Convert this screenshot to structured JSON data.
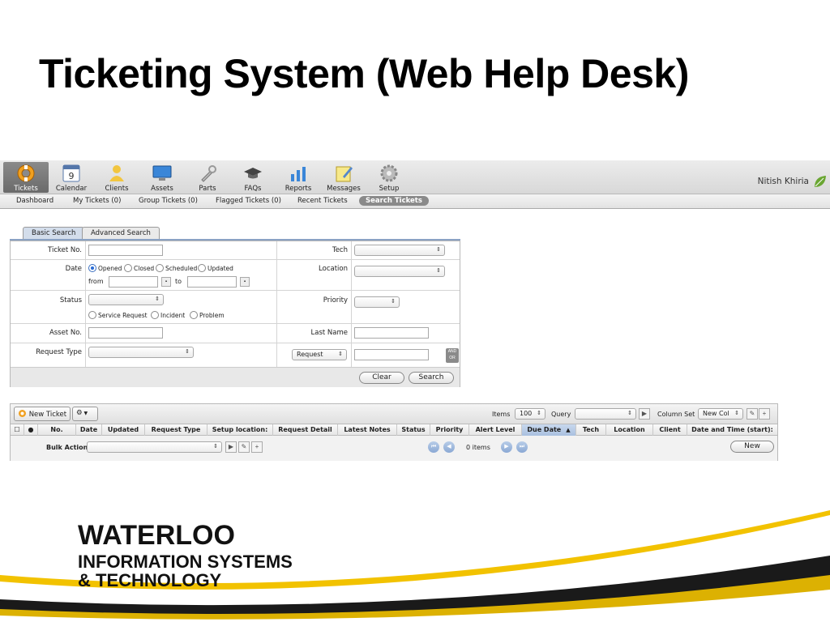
{
  "slide": {
    "title": "Ticketing System (Web Help Desk)"
  },
  "toolbar": {
    "items": [
      {
        "label": "Tickets",
        "icon": "lifebuoy-icon",
        "active": true
      },
      {
        "label": "Calendar",
        "icon": "calendar-icon"
      },
      {
        "label": "Clients",
        "icon": "person-icon"
      },
      {
        "label": "Assets",
        "icon": "monitor-icon"
      },
      {
        "label": "Parts",
        "icon": "wrench-icon"
      },
      {
        "label": "FAQs",
        "icon": "graduation-cap-icon"
      },
      {
        "label": "Reports",
        "icon": "bar-chart-icon"
      },
      {
        "label": "Messages",
        "icon": "notepad-icon"
      },
      {
        "label": "Setup",
        "icon": "gear-icon"
      }
    ],
    "calendar_day": "9",
    "user_name": "Nitish Khiria"
  },
  "subnav": {
    "items": [
      "Dashboard",
      "My Tickets (0)",
      "Group Tickets (0)",
      "Flagged Tickets (0)",
      "Recent Tickets",
      "Search Tickets"
    ],
    "active": "Search Tickets"
  },
  "search": {
    "tabs": [
      "Basic Search",
      "Advanced Search"
    ],
    "active_tab": "Basic Search",
    "labels": {
      "ticket_no": "Ticket No.",
      "date": "Date",
      "status": "Status",
      "asset_no": "Asset No.",
      "request_type": "Request Type",
      "tech": "Tech",
      "location": "Location",
      "priority": "Priority",
      "last_name": "Last Name"
    },
    "date_options": [
      "Opened",
      "Closed",
      "Scheduled",
      "Updated"
    ],
    "date_selected": "Opened",
    "from_label": "from",
    "to_label": "to",
    "type_options": [
      "Service Request",
      "Incident",
      "Problem"
    ],
    "request_select": "Request",
    "and_or": "AND OR",
    "clear_label": "Clear",
    "search_label": "Search"
  },
  "results": {
    "new_ticket_label": "New Ticket",
    "items_label": "Items",
    "items_value": "100",
    "query_label": "Query",
    "column_set_label": "Column Set",
    "column_set_value": "New Col",
    "columns": [
      "No.",
      "Date",
      "Updated",
      "Request Type",
      "Setup location:",
      "Request Detail",
      "Latest Notes",
      "Status",
      "Priority",
      "Alert Level",
      "Due Date",
      "Tech",
      "Location",
      "Client",
      "Date and Time (start):"
    ],
    "sorted_column": "Due Date",
    "bulk_action_label": "Bulk Action",
    "item_count": "0 items",
    "new_label": "New"
  },
  "logo": {
    "line1": "WATERLOO",
    "line2": "INFORMATION SYSTEMS",
    "line3": "& TECHNOLOGY"
  },
  "colors": {
    "accent_blue": "#8aa2c4",
    "swoosh_yellow": "#f2c200",
    "swoosh_dark": "#1a1a1a"
  }
}
